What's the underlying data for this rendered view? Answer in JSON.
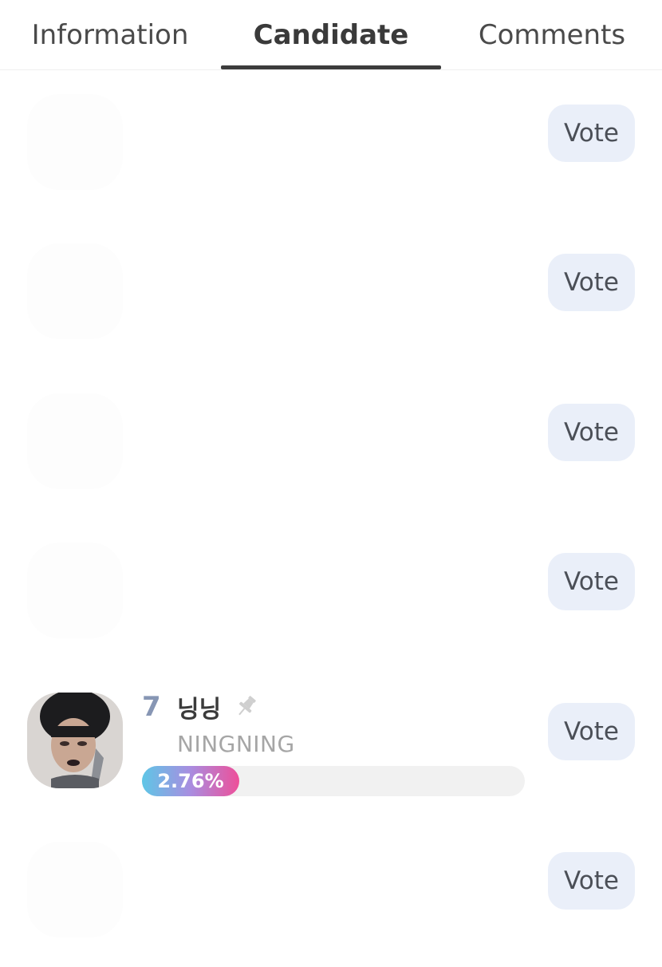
{
  "tabs": [
    {
      "label": "Information"
    },
    {
      "label": "Candidate"
    },
    {
      "label": "Comments"
    }
  ],
  "active_tab": "Candidate",
  "vote_label": "Vote",
  "featured": {
    "rank": "7",
    "name": "닝닝",
    "subname": "NINGNING",
    "percent_label": "2.76%",
    "percent_value": 2.76
  },
  "colors": {
    "accent_gradient_start": "#5ec6e6",
    "accent_gradient_end": "#ee4f99",
    "vote_button_bg": "#eaeff9",
    "rank_color": "#8796b4"
  },
  "icons": {
    "pin": "pin-icon"
  }
}
